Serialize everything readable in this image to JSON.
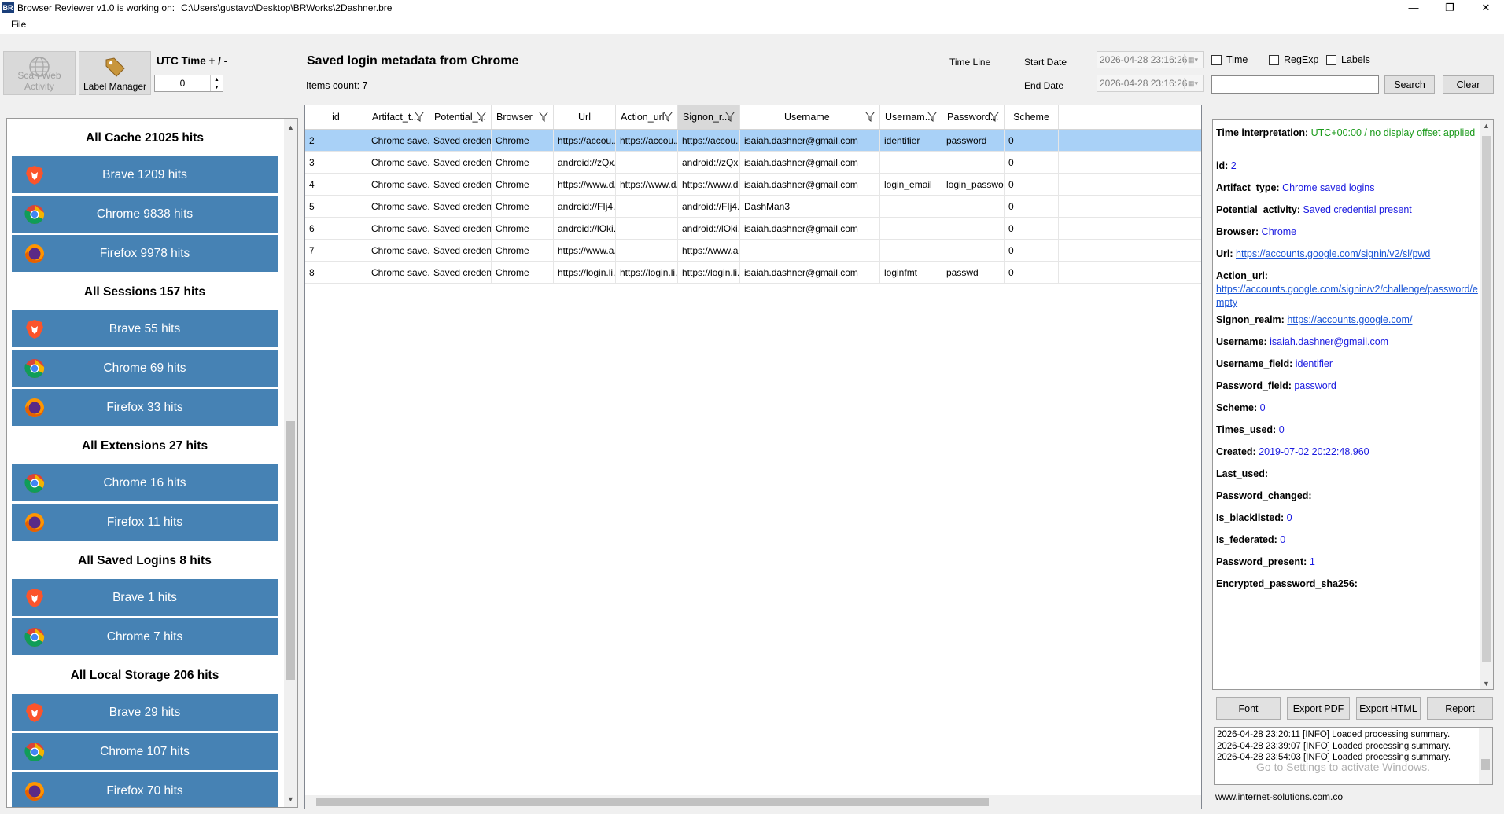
{
  "window": {
    "title": "Browser Reviewer v1.0 is working on:",
    "path": "C:\\Users\\gustavo\\Desktop\\BRWorks\\2Dashner.bre",
    "icon_text": "BR",
    "minimize": "—",
    "restore": "❐",
    "close": "✕"
  },
  "menu": {
    "file": "File"
  },
  "toolbar": {
    "scan_label": "Scan Web Activity",
    "label_manager": "Label Manager",
    "utc_label": "UTC Time + / -",
    "utc_value": "0"
  },
  "main": {
    "title": "Saved login metadata from Chrome",
    "items_count": "Items count: 7"
  },
  "filters": {
    "timeline": "Time Line",
    "start_label": "Start Date",
    "end_label": "End Date",
    "start_value": "2026-04-28 23:16:26",
    "end_value": "2026-04-28 23:16:26",
    "time": "Time",
    "regexp": "RegExp",
    "labels": "Labels",
    "search_btn": "Search",
    "clear_btn": "Clear"
  },
  "sidebar": {
    "groups": [
      {
        "title": "All Cache 21025 hits",
        "items": [
          {
            "label": "Brave 1209 hits",
            "icon": "brave"
          },
          {
            "label": "Chrome 9838 hits",
            "icon": "chrome"
          },
          {
            "label": "Firefox 9978 hits",
            "icon": "firefox"
          }
        ]
      },
      {
        "title": "All Sessions 157 hits",
        "items": [
          {
            "label": "Brave 55 hits",
            "icon": "brave"
          },
          {
            "label": "Chrome 69 hits",
            "icon": "chrome"
          },
          {
            "label": "Firefox 33 hits",
            "icon": "firefox"
          }
        ]
      },
      {
        "title": "All Extensions 27 hits",
        "items": [
          {
            "label": "Chrome 16 hits",
            "icon": "chrome"
          },
          {
            "label": "Firefox 11 hits",
            "icon": "firefox"
          }
        ]
      },
      {
        "title": "All Saved Logins 8 hits",
        "items": [
          {
            "label": "Brave 1 hits",
            "icon": "brave"
          },
          {
            "label": "Chrome 7 hits",
            "icon": "chrome"
          }
        ]
      },
      {
        "title": "All Local Storage 206 hits",
        "items": [
          {
            "label": "Brave 29 hits",
            "icon": "brave"
          },
          {
            "label": "Chrome 107 hits",
            "icon": "chrome"
          },
          {
            "label": "Firefox 70 hits",
            "icon": "firefox"
          }
        ]
      }
    ]
  },
  "grid": {
    "columns": [
      "id",
      "Artifact_t...",
      "Potential_...",
      "Browser",
      "Url",
      "Action_url",
      "Signon_r...",
      "Username",
      "Usernam...",
      "Password...",
      "Scheme"
    ],
    "rows": [
      [
        "2",
        "Chrome save...",
        "Saved creden...",
        "Chrome",
        "https://accou...",
        "https://accou...",
        "https://accou...",
        "isaiah.dashner@gmail.com",
        "identifier",
        "password",
        "0"
      ],
      [
        "3",
        "Chrome save...",
        "Saved creden...",
        "Chrome",
        "android://zQx...",
        "",
        "android://zQx...",
        "isaiah.dashner@gmail.com",
        "",
        "",
        "0"
      ],
      [
        "4",
        "Chrome save...",
        "Saved creden...",
        "Chrome",
        "https://www.d...",
        "https://www.d...",
        "https://www.d...",
        "isaiah.dashner@gmail.com",
        "login_email",
        "login_password",
        "0"
      ],
      [
        "5",
        "Chrome save...",
        "Saved creden...",
        "Chrome",
        "android://FIj4...",
        "",
        "android://FIj4...",
        "DashMan3",
        "",
        "",
        "0"
      ],
      [
        "6",
        "Chrome save...",
        "Saved creden...",
        "Chrome",
        "android://lOki...",
        "",
        "android://lOki...",
        "isaiah.dashner@gmail.com",
        "",
        "",
        "0"
      ],
      [
        "7",
        "Chrome save...",
        "Saved creden...",
        "Chrome",
        "https://www.a...",
        "",
        "https://www.a...",
        "",
        "",
        "",
        "0"
      ],
      [
        "8",
        "Chrome save...",
        "Saved creden...",
        "Chrome",
        "https://login.li...",
        "https://login.li...",
        "https://login.li...",
        "isaiah.dashner@gmail.com",
        "loginfmt",
        "passwd",
        "0"
      ]
    ]
  },
  "detail": {
    "fields": [
      {
        "label": "Time interpretation:",
        "value": "UTC+00:00 / no display offset applied",
        "style": "green"
      },
      {
        "label": "id:",
        "value": "2",
        "style": "blue"
      },
      {
        "label": "Artifact_type:",
        "value": "Chrome saved logins",
        "style": "blue"
      },
      {
        "label": "Potential_activity:",
        "value": "Saved credential present",
        "style": "blue"
      },
      {
        "label": "Browser:",
        "value": "Chrome",
        "style": "blue"
      },
      {
        "label": "Url:",
        "value": "https://accounts.google.com/signin/v2/sl/pwd",
        "style": "link"
      },
      {
        "label": "Action_url:",
        "value": "https://accounts.google.com/signin/v2/challenge/password/empty",
        "style": "link"
      },
      {
        "label": "Signon_realm:",
        "value": "https://accounts.google.com/",
        "style": "link"
      },
      {
        "label": "Username:",
        "value": "isaiah.dashner@gmail.com",
        "style": "blue"
      },
      {
        "label": "Username_field:",
        "value": "identifier",
        "style": "blue"
      },
      {
        "label": "Password_field:",
        "value": "password",
        "style": "blue"
      },
      {
        "label": "Scheme:",
        "value": "0",
        "style": "blue"
      },
      {
        "label": "Times_used:",
        "value": "0",
        "style": "blue"
      },
      {
        "label": "Created:",
        "value": "2019-07-02 20:22:48.960",
        "style": "blue"
      },
      {
        "label": "Last_used:",
        "value": "",
        "style": "blue"
      },
      {
        "label": "Password_changed:",
        "value": "",
        "style": "blue"
      },
      {
        "label": "Is_blacklisted:",
        "value": "0",
        "style": "blue"
      },
      {
        "label": "Is_federated:",
        "value": "0",
        "style": "blue"
      },
      {
        "label": "Password_present:",
        "value": "1",
        "style": "blue"
      },
      {
        "label": "Encrypted_password_sha256:",
        "value": "",
        "style": "blue"
      }
    ]
  },
  "actions": {
    "font": "Font",
    "export_pdf": "Export PDF",
    "export_html": "Export HTML",
    "report": "Report"
  },
  "log": [
    "2026-04-28 23:20:11 [INFO] Loaded processing summary.",
    "2026-04-28 23:39:07 [INFO] Loaded processing summary.",
    "2026-04-28 23:54:03 [INFO] Loaded processing summary."
  ],
  "watermark": "Go to Settings to activate Windows.",
  "footer": "www.internet-solutions.com.co",
  "colors": {
    "accent": "#4682b4",
    "selected_row": "#a9d1f7",
    "value_blue": "#1a1ae0",
    "value_green": "#1a9a1a"
  }
}
